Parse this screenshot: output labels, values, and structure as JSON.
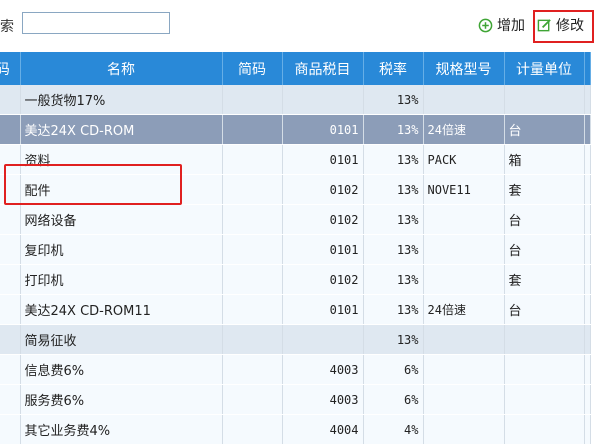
{
  "toolbar": {
    "search_label": "索",
    "search_value": "",
    "add_label": "增加",
    "edit_label": "修改",
    "add_icon": "plus-circle-icon",
    "edit_icon": "edit-icon",
    "add_icon_color": "#3fa535",
    "edit_icon_color": "#3fa535"
  },
  "table": {
    "columns": [
      "码",
      "名称",
      "简码",
      "商品税目",
      "税率",
      "规格型号",
      "计量单位"
    ],
    "header_color": "#2989d8",
    "selected_row_color": "#8c9db8",
    "group_row_color": "#dfe8f1",
    "rows": [
      {
        "type": "group",
        "name": "一般货物17%",
        "code": "",
        "tax_item": "",
        "rate": "13%",
        "spec": "",
        "unit": ""
      },
      {
        "type": "selected",
        "name": "美达24X CD-ROM",
        "code": "",
        "tax_item": "0101",
        "rate": "13%",
        "spec": "24倍速",
        "unit": "台"
      },
      {
        "type": "row",
        "name": "资料",
        "code": "",
        "tax_item": "0101",
        "rate": "13%",
        "spec": "PACK",
        "unit": "箱"
      },
      {
        "type": "row",
        "name": "配件",
        "code": "",
        "tax_item": "0102",
        "rate": "13%",
        "spec": "NOVE11",
        "unit": "套"
      },
      {
        "type": "row",
        "name": "网络设备",
        "code": "",
        "tax_item": "0102",
        "rate": "13%",
        "spec": "",
        "unit": "台"
      },
      {
        "type": "row",
        "name": "复印机",
        "code": "",
        "tax_item": "0101",
        "rate": "13%",
        "spec": "",
        "unit": "台"
      },
      {
        "type": "row",
        "name": "打印机",
        "code": "",
        "tax_item": "0102",
        "rate": "13%",
        "spec": "",
        "unit": "套"
      },
      {
        "type": "row",
        "name": "美达24X CD-ROM11",
        "code": "",
        "tax_item": "0101",
        "rate": "13%",
        "spec": "24倍速",
        "unit": "台"
      },
      {
        "type": "group",
        "name": "简易征收",
        "code": "",
        "tax_item": "",
        "rate": "13%",
        "spec": "",
        "unit": ""
      },
      {
        "type": "row",
        "name": "信息费6%",
        "code": "",
        "tax_item": "4003",
        "rate": "6%",
        "spec": "",
        "unit": ""
      },
      {
        "type": "row",
        "name": "服务费6%",
        "code": "",
        "tax_item": "4003",
        "rate": "6%",
        "spec": "",
        "unit": ""
      },
      {
        "type": "row",
        "name": "其它业务费4%",
        "code": "",
        "tax_item": "4004",
        "rate": "4%",
        "spec": "",
        "unit": ""
      }
    ]
  }
}
